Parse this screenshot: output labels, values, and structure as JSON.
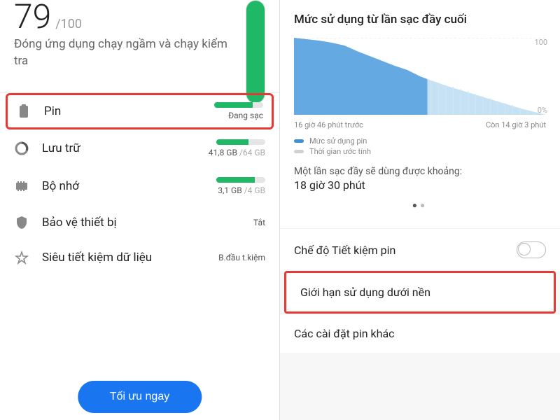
{
  "left": {
    "score": "79",
    "score_max": "/100",
    "subtitle": "Đóng ứng dụng chạy ngầm và chạy kiểm tra",
    "items": {
      "pin": {
        "label": "Pin",
        "sub": "Đang sạc",
        "fill": 78
      },
      "storage": {
        "label": "Lưu trữ",
        "used": "41,8 GB",
        "total": " /64 GB",
        "fill": 65
      },
      "memory": {
        "label": "Bộ nhớ",
        "used": "3,1 GB",
        "total": " /4 GB",
        "fill": 78
      },
      "security": {
        "label": "Bảo vệ thiết bị",
        "sub": "Tắt"
      },
      "datasaver": {
        "label": "Siêu tiết kiệm dữ liệu",
        "sub": "B.đầu t.kiệm"
      }
    },
    "optimize": "Tối ưu ngay"
  },
  "right": {
    "title": "Mức sử dụng từ lần sạc đầy cuối",
    "xleft": "16 giờ 46 phút trước",
    "xright": "Còn 14 giờ 3 phút",
    "legend_usage": "Mức sử dụng pin",
    "legend_est": "Thời gian ước tính",
    "estimate_label": "Một lần sạc đầy sẽ dùng được khoảng:",
    "estimate_value": "18 giờ 30 phút",
    "settings": {
      "powersave": "Chế độ Tiết kiệm pin",
      "bglimit": "Giới hạn sử dụng dưới nền",
      "other": "Các cài đặt pin khác"
    }
  },
  "chart_data": {
    "type": "area",
    "title": "Mức sử dụng từ lần sạc đầy cuối",
    "xlabel": "",
    "ylabel": "%",
    "ylim": [
      0,
      100
    ],
    "series": [
      {
        "name": "Mức sử dụng pin",
        "color": "#3d8fd6",
        "x": [
          0,
          5,
          10,
          15,
          20,
          25,
          30,
          35,
          40,
          45,
          50,
          53
        ],
        "values": [
          100,
          98,
          96,
          94,
          90,
          83,
          76,
          70,
          64,
          58,
          50,
          46
        ]
      },
      {
        "name": "Thời gian ước tính",
        "color": "#cfe6f7",
        "x": [
          53,
          60,
          70,
          80,
          90,
          100
        ],
        "values": [
          46,
          38,
          28,
          18,
          8,
          0
        ]
      }
    ],
    "x_annotations": {
      "0": "16 giờ 46 phút trước",
      "100": "Còn 14 giờ 3 phút"
    }
  }
}
